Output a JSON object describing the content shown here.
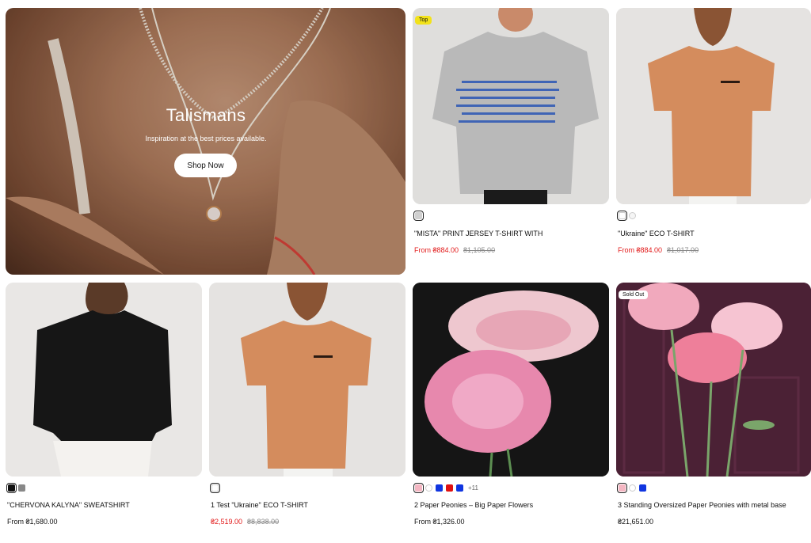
{
  "hero": {
    "title": "Talismans",
    "subtitle": "Inspiration at the best prices available.",
    "button_label": "Shop Now"
  },
  "products": [
    {
      "title": "\"MISTA\" PRINT JERSEY T-SHIRT WITH",
      "price": "From ₴884.00",
      "old_price": "₴1,105.00",
      "badge": "Top",
      "swatches": [
        "#cfcfcf"
      ]
    },
    {
      "title": "\"Ukraine\" ECO T-SHIRT",
      "price": "From ₴884.00",
      "old_price": "₴1,017.00",
      "swatches": [
        "#ffffff",
        "#f5f5f5"
      ]
    },
    {
      "title": "\"CHERVONA KALYNA\" SWEATSHIRT",
      "price": "From ₴1,680.00",
      "swatches": [
        "#111111",
        "#888888"
      ]
    },
    {
      "title": "1 Test \"Ukraine\" ECO T-SHIRT",
      "price": "₴2,519.00",
      "old_price": "₴8,838.00",
      "swatches": [
        "#ffffff"
      ]
    },
    {
      "title": "2 Paper Peonies – Big Paper Flowers",
      "price": "From ₴1,326.00",
      "swatches": [
        "#f4b6c2",
        "#ffffff",
        "#1035e0",
        "#e01010",
        "#1035e0"
      ],
      "more": "+11"
    },
    {
      "title": "3 Standing Oversized Paper Peonies with metal base",
      "price": "₴21,651.00",
      "badge": "Sold Out",
      "swatches": [
        "#f4b6c2",
        "#ffffff",
        "#1035e0"
      ]
    }
  ],
  "colors": {
    "sale": "#e21b1b",
    "badge_top": "#f2e21a"
  }
}
